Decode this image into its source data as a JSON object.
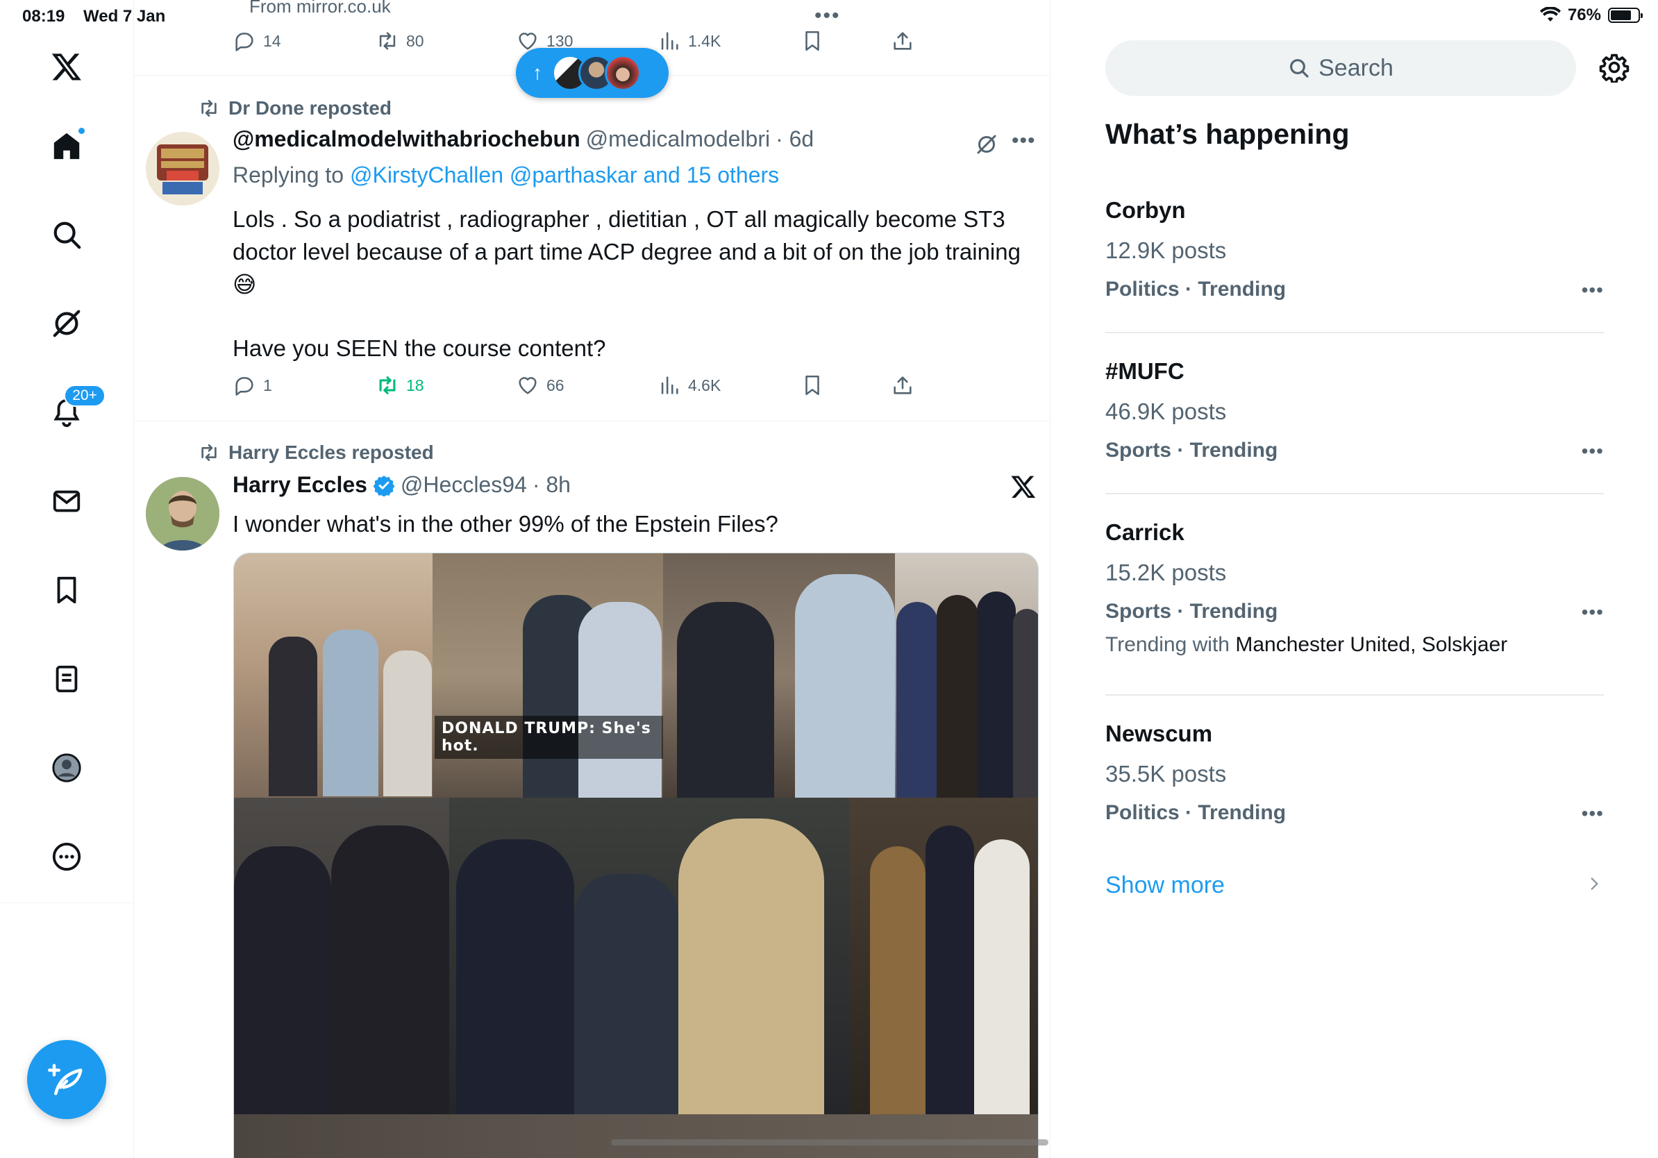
{
  "status_bar": {
    "time": "08:19",
    "date": "Wed 7 Jan",
    "battery": "76%",
    "battery_level": 0.76
  },
  "nav": {
    "items": [
      "x-logo",
      "home",
      "explore",
      "grok",
      "notifications",
      "messages",
      "bookmarks",
      "lists",
      "profile",
      "more"
    ],
    "notification_badge": "20+",
    "home_has_dot": true
  },
  "timeline": {
    "previous_post": {
      "source": "From mirror.co.uk",
      "replies": "14",
      "reposts": "80",
      "likes": "130",
      "views": "1.4K"
    },
    "new_posts_pill": {
      "arrow": "↑"
    },
    "posts": [
      {
        "reposted_by": "Dr Done reposted",
        "name": "@medicalmodelwithabriochebun",
        "handle": "@medicalmodelbri",
        "time": "· 6d",
        "replying_prefix": "Replying to",
        "replying_links": "@KirstyChallen @parthaskar and 15 others",
        "text_line1": "Lols . So a podiatrist , radiographer , dietitian , OT all magically become ST3 doctor level because of a part time ACP degree and a bit of on the job training 😅",
        "text_line2": "Have you SEEN the course content?",
        "replies": "1",
        "reposts": "18",
        "likes": "66",
        "views": "4.6K"
      },
      {
        "reposted_by": "Harry Eccles reposted",
        "name": "Harry Eccles",
        "handle": "@Heccles94",
        "time": "· 8h",
        "text": "I wonder what's in the other 99% of the Epstein Files?",
        "media_caption": "DONALD TRUMP: She's hot."
      }
    ]
  },
  "sidebar": {
    "search_placeholder": "Search",
    "section_title": "What’s happening",
    "trends": [
      {
        "name": "Corbyn",
        "count": "12.9K posts",
        "category": "Politics · Trending"
      },
      {
        "name": "#MUFC",
        "count": "46.9K posts",
        "category": "Sports · Trending"
      },
      {
        "name": "Carrick",
        "count": "15.2K posts",
        "category": "Sports · Trending",
        "with_prefix": "Trending with",
        "with_names": "Manchester United, Solskjaer"
      },
      {
        "name": "Newscum",
        "count": "35.5K posts",
        "category": "Politics · Trending"
      }
    ],
    "show_more": "Show more"
  },
  "colors": {
    "accent": "#1d9bf0",
    "repost_active": "#00ba7c",
    "text_secondary": "#536471"
  }
}
